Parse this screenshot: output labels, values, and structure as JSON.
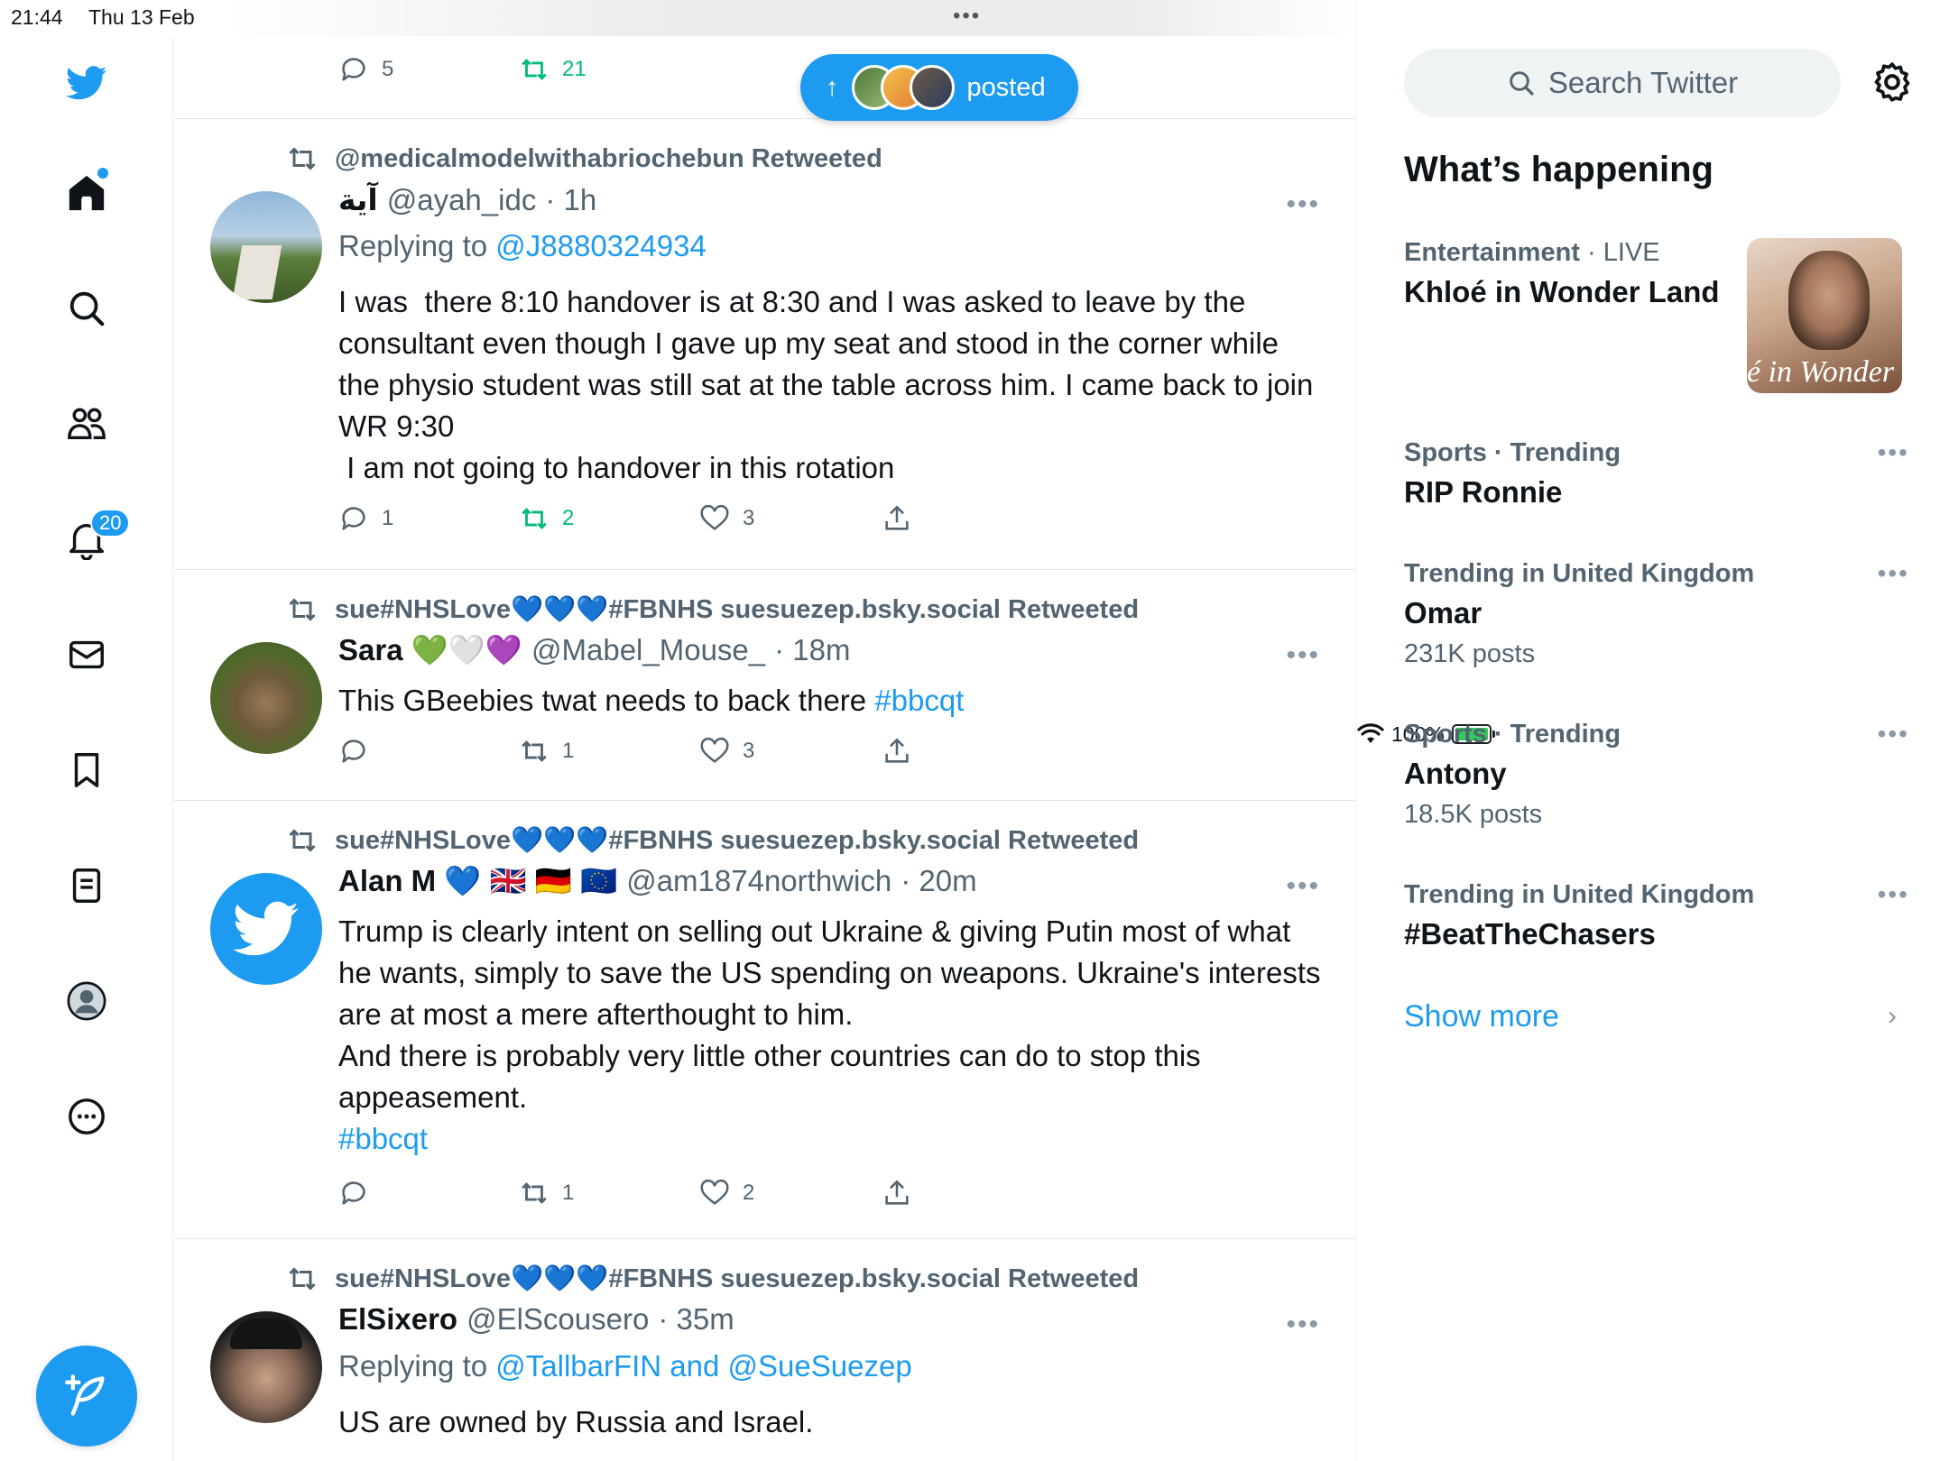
{
  "status": {
    "time": "21:44",
    "date": "Thu 13 Feb",
    "battery": "100%",
    "more": "•••"
  },
  "nav": {
    "notifications_badge": "20"
  },
  "posted_pill": {
    "label": "posted",
    "arrow": "↑"
  },
  "tweets": [
    {
      "reply_count": "5",
      "retweet_count": "21"
    },
    {
      "retweeted_by": "@medicalmodelwithabriochebun Retweeted",
      "name": "آية",
      "handle": "@ayah_idc",
      "time": "· 1h",
      "reply_prefix": "Replying to ",
      "reply_to": "@J8880324934",
      "text": "I was  there 8:10 handover is at 8:30 and I was asked to leave by the consultant even though I gave up my seat and stood in the corner while the physio student was still sat at the table across him. I came back to join WR 9:30\n I am not going to handover in this rotation",
      "reply_count": "1",
      "retweet_count": "2",
      "like_count": "3"
    },
    {
      "retweeted_by": "sue#NHSLove💙💙💙#FBNHS suesuezep.bsky.social Retweeted",
      "name": "Sara 💚🤍💜",
      "handle": "@Mabel_Mouse_",
      "time": "· 18m",
      "text": "This GBeebies twat needs to back there ",
      "hashtag": "#bbcqt",
      "reply_count": "",
      "retweet_count": "1",
      "like_count": "3"
    },
    {
      "retweeted_by": "sue#NHSLove💙💙💙#FBNHS suesuezep.bsky.social Retweeted",
      "name": "Alan M 💙 🇬🇧 🇩🇪 🇪🇺",
      "handle": "@am1874northwich",
      "time": "· 20m",
      "text": "Trump is clearly intent on selling out Ukraine & giving Putin most of what he wants, simply to save the US spending on weapons. Ukraine's interests are at most a mere afterthought to him.\nAnd there is probably very little other countries can do to stop this appeasement.",
      "hashtag": "#bbcqt",
      "reply_count": "",
      "retweet_count": "1",
      "like_count": "2"
    },
    {
      "retweeted_by": "sue#NHSLove💙💙💙#FBNHS suesuezep.bsky.social Retweeted",
      "name": "ElSixero",
      "handle": "@ElScousero",
      "time": "· 35m",
      "reply_prefix": "Replying to ",
      "reply_to": "@TallbarFIN and @SueSuezep",
      "text": "US are owned by Russia and Israel."
    }
  ],
  "sidebar": {
    "search_placeholder": "Search Twitter",
    "heading": "What’s happening",
    "trends": [
      {
        "category": "Entertainment",
        "extra": " · LIVE",
        "title": "Khloé in Wonder Land",
        "count": ""
      },
      {
        "category": "Sports · Trending",
        "extra": "",
        "title": "RIP Ronnie",
        "count": ""
      },
      {
        "category": "Trending in United Kingdom",
        "extra": "",
        "title": "Omar",
        "count": "231K posts"
      },
      {
        "category": "Sports · Trending",
        "extra": "",
        "title": "Antony",
        "count": "18.5K posts"
      },
      {
        "category": "Trending in United Kingdom",
        "extra": "",
        "title": "#BeatTheChasers",
        "count": ""
      }
    ],
    "trend_image_caption": "é in Wonder L",
    "show_more": "Show more",
    "more_glyph": "•••"
  },
  "colors": {
    "accent": "#1d9bf0",
    "retweet_green": "#00ba7c",
    "muted": "#536471"
  }
}
